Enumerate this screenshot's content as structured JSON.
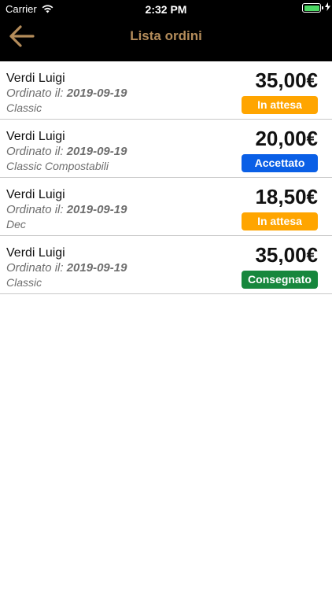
{
  "status_bar": {
    "carrier": "Carrier",
    "time": "2:32 PM",
    "battery_color": "#4cd964"
  },
  "nav": {
    "title": "Lista ordini",
    "back_icon": "arrow-left-icon",
    "accent_color": "#b48c5a"
  },
  "orders": [
    {
      "name": "Verdi Luigi",
      "date_label": "Ordinato il:",
      "date": "2019-09-19",
      "type": "Classic",
      "price": "35,00€",
      "status": "In attesa",
      "status_color": "#ffa500"
    },
    {
      "name": "Verdi Luigi",
      "date_label": "Ordinato il:",
      "date": "2019-09-19",
      "type": "Classic Compostabili",
      "price": "20,00€",
      "status": "Accettato",
      "status_color": "#0a5fe6"
    },
    {
      "name": "Verdi Luigi",
      "date_label": "Ordinato il:",
      "date": "2019-09-19",
      "type": "Dec",
      "price": "18,50€",
      "status": "In attesa",
      "status_color": "#ffa500"
    },
    {
      "name": "Verdi Luigi",
      "date_label": "Ordinato il:",
      "date": "2019-09-19",
      "type": "Classic",
      "price": "35,00€",
      "status": "Consegnato",
      "status_color": "#17873d"
    }
  ]
}
